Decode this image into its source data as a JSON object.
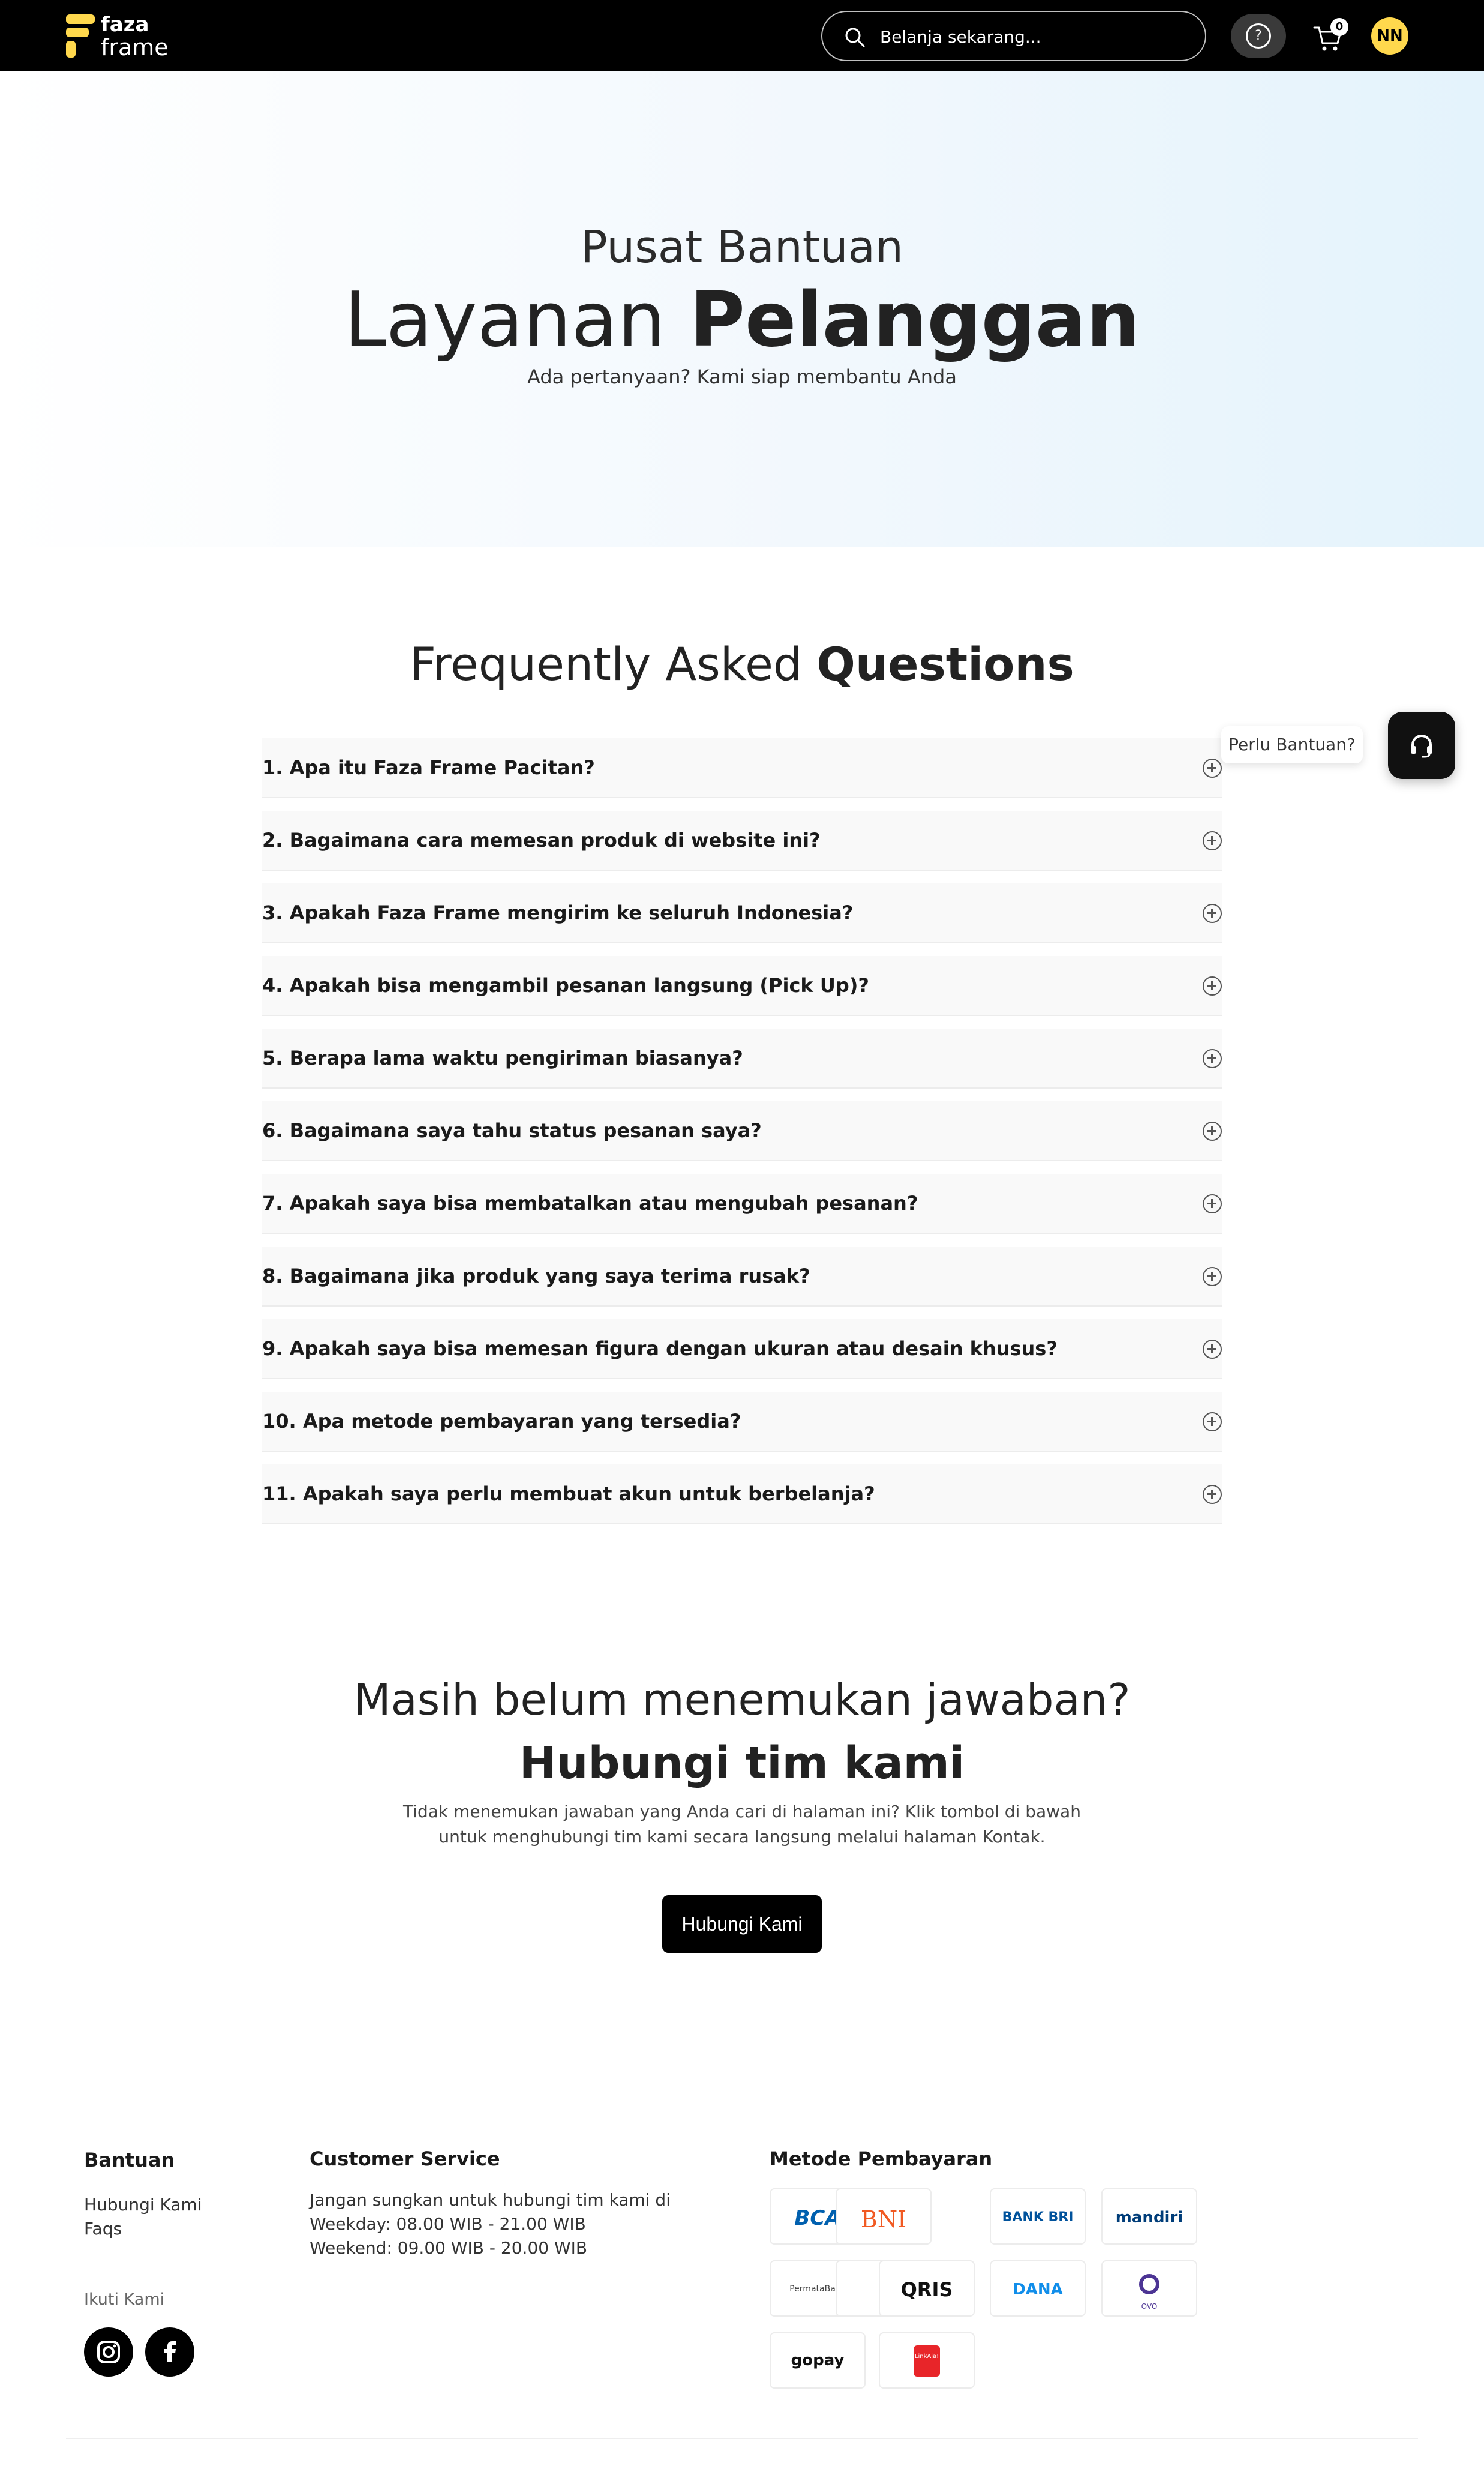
{
  "header": {
    "logo_line1": "faza",
    "logo_line2": "frame",
    "search_placeholder": "Belanja sekarang...",
    "help_glyph": "?",
    "cart_count": "0",
    "avatar_initials": "NN"
  },
  "hero": {
    "subtitle": "Pusat Bantuan",
    "title_regular": "Layanan",
    "title_bold": "Pelanggan",
    "description": "Ada pertanyaan? Kami siap membantu Anda"
  },
  "faq": {
    "title_regular": "Frequently Asked",
    "title_bold": "Questions",
    "items": [
      "1. Apa itu Faza Frame Pacitan?",
      "2. Bagaimana cara memesan produk di website ini?",
      "3. Apakah Faza Frame mengirim ke seluruh Indonesia?",
      "4. Apakah bisa mengambil pesanan langsung (Pick Up)?",
      "5. Berapa lama waktu pengiriman biasanya?",
      "6. Bagaimana saya tahu status pesanan saya?",
      "7. Apakah saya bisa membatalkan atau mengubah pesanan?",
      "8. Bagaimana jika produk yang saya terima rusak?",
      "9. Apakah saya bisa memesan figura dengan ukuran atau desain khusus?",
      "10. Apa metode pembayaran yang tersedia?",
      "11. Apakah saya perlu membuat akun untuk berbelanja?"
    ]
  },
  "floating_help": {
    "tooltip": "Perlu Bantuan?"
  },
  "cta": {
    "line1": "Masih belum menemukan jawaban?",
    "line2": "Hubungi tim kami",
    "description": "Tidak menemukan jawaban yang Anda cari di halaman ini? Klik tombol di bawah untuk menghubungi tim kami secara langsung melalui halaman Kontak.",
    "button": "Hubungi Kami"
  },
  "footer": {
    "bantuan_heading": "Bantuan",
    "bantuan_links": [
      "Hubungi Kami",
      "Faqs"
    ],
    "follow_label": "Ikuti Kami",
    "cs_heading": "Customer Service",
    "cs_lines": [
      "Jangan sungkan untuk hubungi tim kami di",
      "Weekday: 08.00 WIB - 21.00 WIB",
      "Weekend: 09.00 WIB - 20.00 WIB"
    ],
    "payment_heading": "Metode Pembayaran",
    "payment_methods": [
      "BCA",
      "BNI",
      "BANK BRI",
      "mandiri",
      "PermataBank",
      "QRIS",
      "DANA",
      "OVO",
      "gopay",
      "LinkAja!"
    ],
    "social_icons": [
      "instagram-icon",
      "facebook-icon"
    ]
  },
  "colors": {
    "brand_yellow": "#FFD84D",
    "header_bg": "#000000",
    "faq_row_bg": "#f9f9f9",
    "bca_blue": "#0060af",
    "bni_orange": "#f15a23",
    "bri_blue": "#00529c",
    "mandiri_blue": "#003d79",
    "dana_blue": "#118eea",
    "ovo_purple": "#4c3494",
    "linkaja_red": "#e82529"
  }
}
